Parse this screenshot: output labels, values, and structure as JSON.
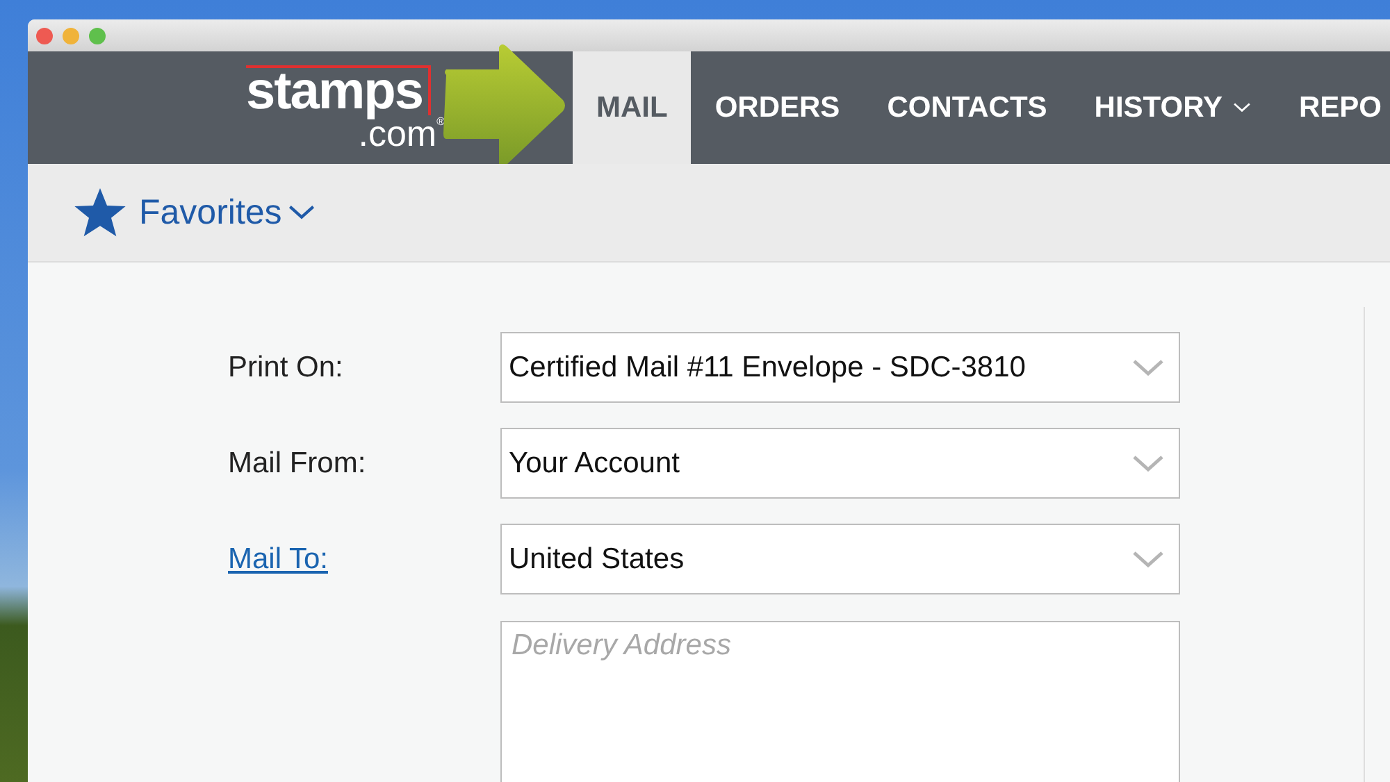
{
  "logo": {
    "name": "stamps",
    "suffix": ".com",
    "mark": "®"
  },
  "nav": {
    "tabs": [
      {
        "label": "MAIL",
        "selected": true,
        "dropdown": false
      },
      {
        "label": "ORDERS",
        "selected": false,
        "dropdown": false
      },
      {
        "label": "CONTACTS",
        "selected": false,
        "dropdown": false
      },
      {
        "label": "HISTORY",
        "selected": false,
        "dropdown": true
      },
      {
        "label": "REPO",
        "selected": false,
        "dropdown": false
      }
    ]
  },
  "favorites": {
    "label": "Favorites"
  },
  "form": {
    "rows": [
      {
        "label": "Print On:",
        "link": false,
        "value": "Certified Mail #11 Envelope - SDC-3810"
      },
      {
        "label": "Mail From:",
        "link": false,
        "value": "Your Account"
      },
      {
        "label": "Mail To:",
        "link": true,
        "value": "United States"
      }
    ],
    "address": {
      "placeholder": "Delivery Address"
    }
  }
}
